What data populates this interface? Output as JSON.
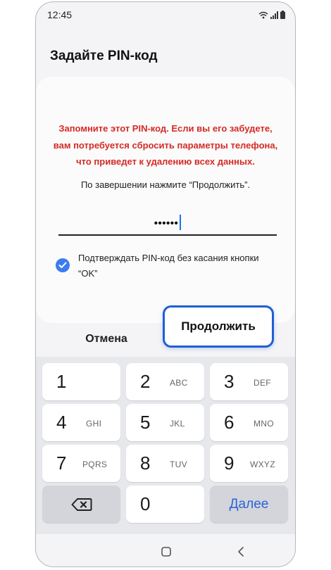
{
  "status_bar": {
    "time": "12:45"
  },
  "title": "Задайте PIN-код",
  "warning": {
    "line1": "Запомните этот PIN-код. Если вы его забудете,",
    "line2": "вам потребуется сбросить параметры телефона,",
    "line3": "что приведет к удалению всех данных."
  },
  "instruction": "По завершении нажмите “Продолжить”.",
  "pin": {
    "value": "••••••"
  },
  "checkbox": {
    "label_line1": "Подтверждать PIN-код без касания кнопки",
    "label_line2": "“OK”",
    "checked": true
  },
  "buttons": {
    "cancel": "Отмена",
    "continue": "Продолжить"
  },
  "keypad": {
    "keys": [
      {
        "digit": "1",
        "letters": ""
      },
      {
        "digit": "2",
        "letters": "ABC"
      },
      {
        "digit": "3",
        "letters": "DEF"
      },
      {
        "digit": "4",
        "letters": "GHI"
      },
      {
        "digit": "5",
        "letters": "JKL"
      },
      {
        "digit": "6",
        "letters": "MNO"
      },
      {
        "digit": "7",
        "letters": "PQRS"
      },
      {
        "digit": "8",
        "letters": "TUV"
      },
      {
        "digit": "9",
        "letters": "WXYZ"
      },
      {
        "digit": "0",
        "letters": ""
      }
    ],
    "next_label": "Далее",
    "backspace_icon": "backspace-icon"
  },
  "colors": {
    "warning": "#d42b24",
    "accent": "#1f5fd4",
    "checkbox": "#3d7cf0",
    "next": "#2b63d6"
  }
}
